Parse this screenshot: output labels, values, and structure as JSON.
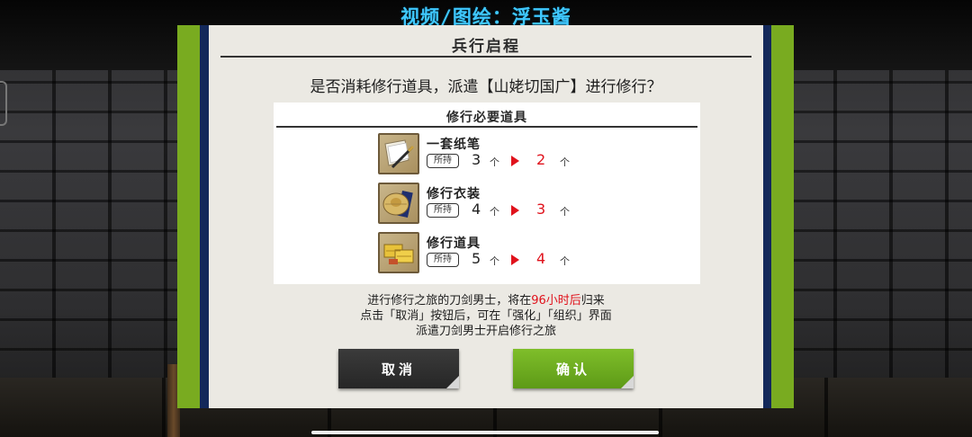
{
  "watermark": "视频/图绘：浮玉酱",
  "dialog": {
    "title": "兵行启程",
    "prompt": "是否消耗修行道具，派遣【山姥切国广】进行修行？",
    "requirements": {
      "header": "修行必要道具",
      "owned_label": "所持",
      "unit": "个",
      "items": [
        {
          "name": "一套纸笔",
          "icon": "paper-brush-icon",
          "owned": "3",
          "after": "2"
        },
        {
          "name": "修行衣装",
          "icon": "travel-hat-icon",
          "owned": "4",
          "after": "3"
        },
        {
          "name": "修行道具",
          "icon": "travel-tools-icon",
          "owned": "5",
          "after": "4"
        }
      ]
    },
    "notes": {
      "line1_prefix": "进行修行之旅的刀剑男士，将在",
      "line1_highlight": "96小时后",
      "line1_suffix": "归来",
      "line2": "点击「取消」按钮后，可在「强化」「组织」界面",
      "line3": "派遣刀剑男士开启修行之旅"
    },
    "buttons": {
      "cancel": "取消",
      "confirm": "确认"
    }
  },
  "colors": {
    "frame_green": "#79ab20",
    "frame_navy": "#13285a",
    "confirm_green": "#6fae20",
    "cancel_dark": "#303030",
    "highlight_red": "#e0121c",
    "watermark_cyan": "#3fc8ff"
  }
}
